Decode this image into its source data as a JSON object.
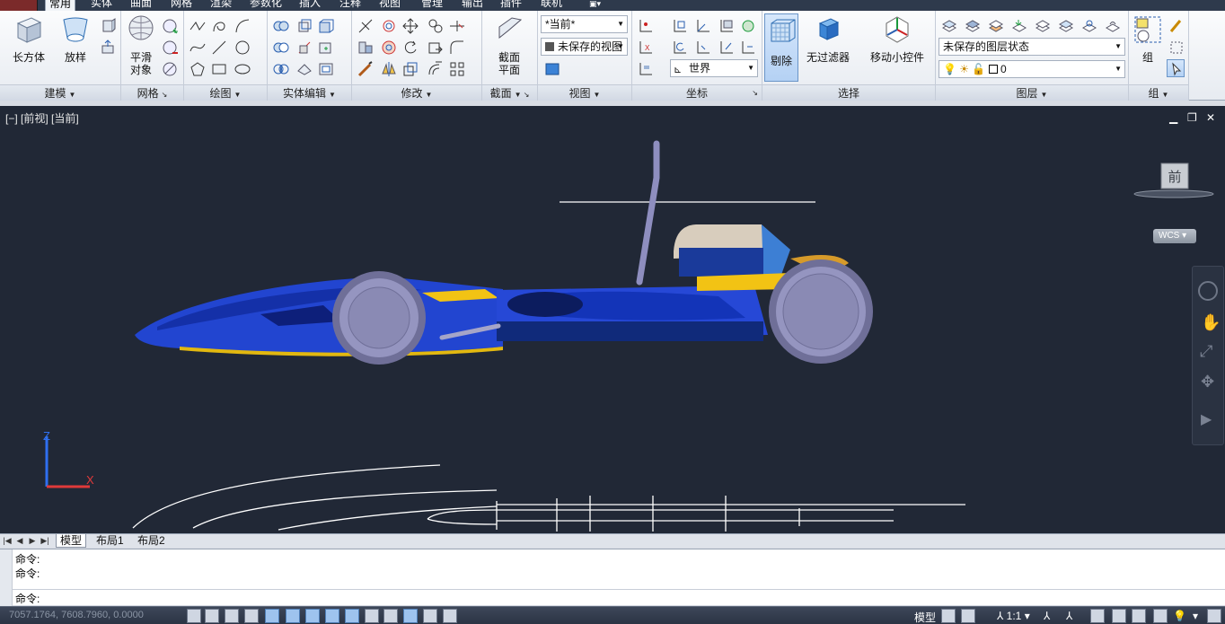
{
  "ribbon_tabs": [
    "常用",
    "实体",
    "曲面",
    "网格",
    "渲染",
    "参数化",
    "插入",
    "注释",
    "视图",
    "管理",
    "输出",
    "插件",
    "联机"
  ],
  "ribbon_active_tab": "常用",
  "panels": {
    "modeling": {
      "title": "建模",
      "box_label": "长方体",
      "loft_label": "放样"
    },
    "mesh": {
      "title": "网格",
      "smooth_label_1": "平滑",
      "smooth_label_2": "对象"
    },
    "draw": {
      "title": "绘图"
    },
    "solid_edit": {
      "title": "实体编辑"
    },
    "modify": {
      "title": "修改"
    },
    "section": {
      "title": "截面",
      "plane_label_1": "截面",
      "plane_label_2": "平面"
    },
    "view": {
      "title": "视图",
      "visual_style": "*当前*",
      "named_view": "未保存的视图"
    },
    "coordinates": {
      "title": "坐标",
      "ucs": "世界"
    },
    "selection": {
      "title": "选择",
      "cull_label": "剔除",
      "filter_label": "无过滤器",
      "gizmo_label": "移动小控件"
    },
    "layers": {
      "title": "图层",
      "layer_state": "未保存的图层状态",
      "current_layer": "0"
    },
    "groups": {
      "title": "组",
      "group_label": "组"
    }
  },
  "viewport": {
    "label": "[−] [前视] [当前]",
    "viewcube_face": "前",
    "wcs_label": "WCS",
    "axis_z": "Z",
    "axis_x": "X"
  },
  "layout_tabs": [
    "模型",
    "布局1",
    "布局2"
  ],
  "layout_active": "模型",
  "command_history": [
    "命令:",
    "命令:"
  ],
  "command_prompt": "命令:",
  "status": {
    "coordinates": "7057.1764, 7608.7960, 0.0000",
    "model_label": "模型",
    "annotation_scale": "1:1"
  },
  "colors": {
    "viewport_bg": "#212836",
    "car_body": "#1f3fc4",
    "car_dark": "#0f1f7a",
    "car_accent": "#f2c314",
    "wheel": "#8f8fb6",
    "axis_z": "#2f6ff0",
    "axis_x": "#e03a3a"
  }
}
